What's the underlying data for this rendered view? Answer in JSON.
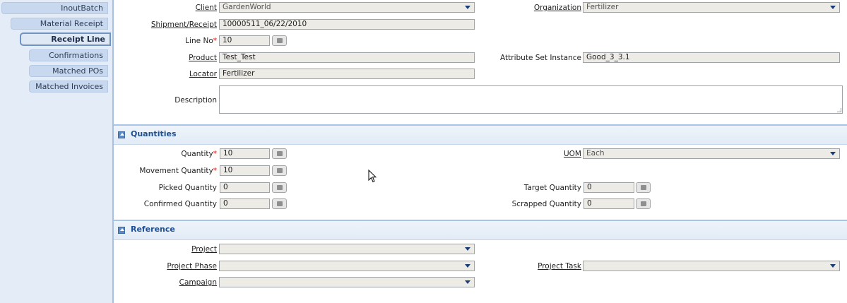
{
  "tabs": {
    "inoutbatch": "InoutBatch",
    "material_receipt": "Material Receipt",
    "receipt_line": "Receipt Line",
    "confirmations": "Confirmations",
    "matched_pos": "Matched POs",
    "matched_invoices": "Matched Invoices"
  },
  "main": {
    "client": {
      "label": "Client",
      "value": "GardenWorld"
    },
    "organization": {
      "label": "Organization",
      "value": "Fertilizer"
    },
    "shipment_receipt": {
      "label": "Shipment/Receipt",
      "value": "10000511_06/22/2010"
    },
    "line_no": {
      "label": "Line No",
      "value": "10"
    },
    "product": {
      "label": "Product",
      "value": "Test_Test"
    },
    "attribute_set_instance": {
      "label": "Attribute Set Instance",
      "value": "Good_3_3.1"
    },
    "locator": {
      "label": "Locator",
      "value": "Fertilizer"
    },
    "description": {
      "label": "Description",
      "value": ""
    }
  },
  "quantities": {
    "title": "Quantities",
    "quantity": {
      "label": "Quantity",
      "value": "10"
    },
    "uom": {
      "label": "UOM",
      "value": "Each"
    },
    "movement_quantity": {
      "label": "Movement Quantity",
      "value": "10"
    },
    "picked_quantity": {
      "label": "Picked Quantity",
      "value": "0"
    },
    "target_quantity": {
      "label": "Target Quantity",
      "value": "0"
    },
    "confirmed_quantity": {
      "label": "Confirmed Quantity",
      "value": "0"
    },
    "scrapped_quantity": {
      "label": "Scrapped Quantity",
      "value": "0"
    }
  },
  "reference": {
    "title": "Reference",
    "project": {
      "label": "Project",
      "value": ""
    },
    "project_phase": {
      "label": "Project Phase",
      "value": ""
    },
    "project_task": {
      "label": "Project Task",
      "value": ""
    },
    "campaign": {
      "label": "Campaign",
      "value": ""
    }
  },
  "colors": {
    "accent": "#1e4f93",
    "required": "#d01010",
    "field_bg": "#ecebe6",
    "sidebar_bg": "#e4ecf7",
    "tab_bg": "#c8d9ef"
  },
  "icons": [
    "calculator-icon",
    "dropdown-caret-icon",
    "collapse-section-icon",
    "mouse-pointer-icon",
    "resize-grip-icon"
  ]
}
